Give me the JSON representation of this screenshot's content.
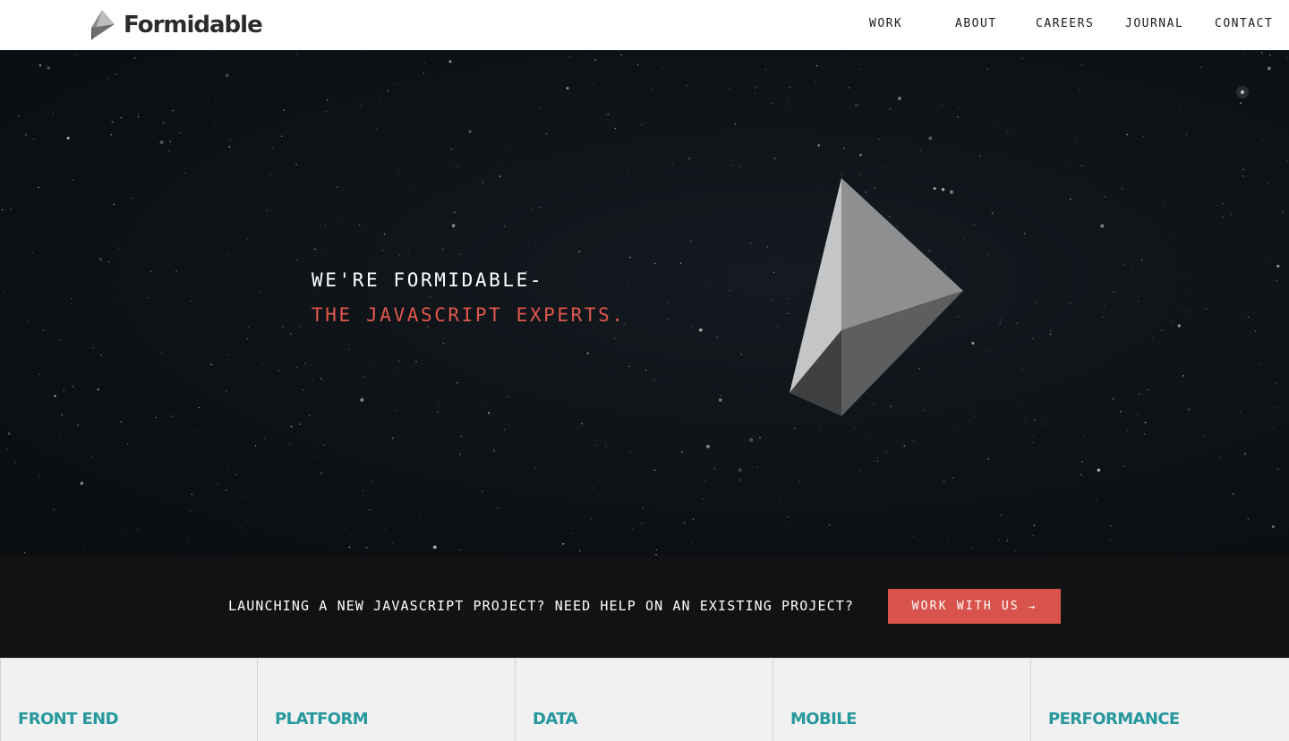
{
  "header": {
    "brand": "Formidable",
    "logo_icon": "formidable-prism-logo",
    "nav": [
      {
        "label": "WORK"
      },
      {
        "label": "ABOUT"
      },
      {
        "label": "CAREERS"
      },
      {
        "label": "JOURNAL"
      },
      {
        "label": "CONTACT"
      }
    ]
  },
  "hero": {
    "line1": "WE'RE FORMIDABLE-",
    "line2": "THE JAVASCRIPT EXPERTS.",
    "accent_color": "#e0574c",
    "background": "starfield"
  },
  "cta": {
    "text": "LAUNCHING A NEW JAVASCRIPT PROJECT? NEED HELP ON AN EXISTING PROJECT?",
    "button_label": "WORK WITH US",
    "button_icon": "arrow-right-icon",
    "button_color": "#d7534b"
  },
  "services": [
    {
      "title": "FRONT END"
    },
    {
      "title": "PLATFORM"
    },
    {
      "title": "DATA"
    },
    {
      "title": "MOBILE"
    },
    {
      "title": "PERFORMANCE"
    }
  ],
  "colors": {
    "brand_teal": "#26989e",
    "dark_band": "#121212"
  }
}
